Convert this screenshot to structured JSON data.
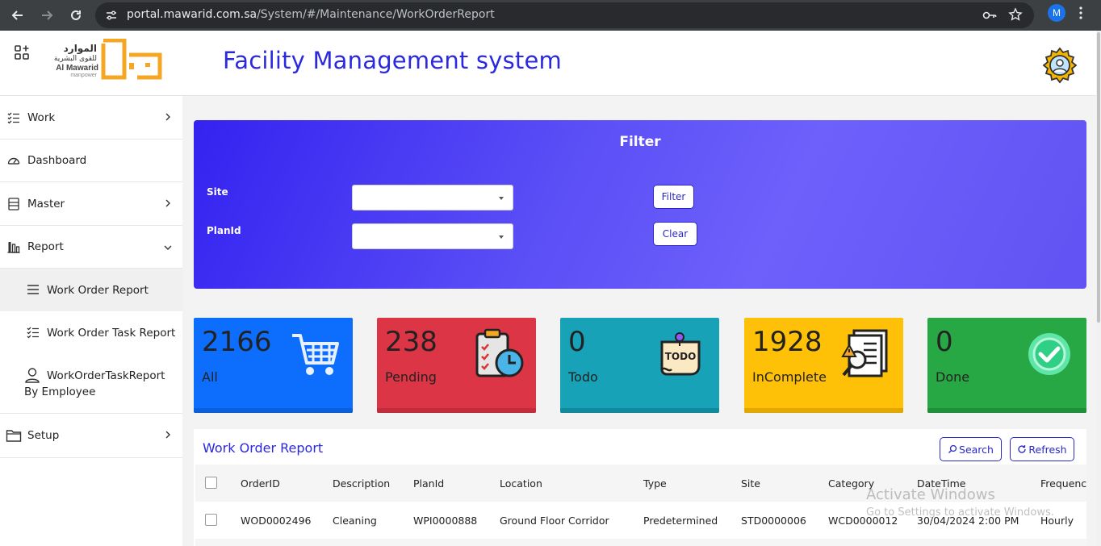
{
  "browser": {
    "url_host": "portal.mawarid.com.sa",
    "url_path": "/System/#/Maintenance/WorkOrderReport",
    "profile_initial": "M"
  },
  "header": {
    "logo_ar": "الموارد",
    "logo_ar_sub": "للقوى البشرية",
    "logo_en": "Al Mawarid",
    "logo_en_sub": "manpower",
    "title": "Facility Management system"
  },
  "sidebar": {
    "items": [
      {
        "label": "Work",
        "icon": "checklist-icon"
      },
      {
        "label": "Dashboard",
        "icon": "speedometer-icon"
      },
      {
        "label": "Master",
        "icon": "list-box-icon"
      },
      {
        "label": "Report",
        "icon": "bar-chart-icon"
      },
      {
        "label": "Work Order Report",
        "icon": "menu-lines-icon"
      },
      {
        "label": "Work Order Task Report",
        "icon": "checklist-icon"
      },
      {
        "label": "WorkOrderTaskReport",
        "label2": "By Employee",
        "icon": "person-icon"
      },
      {
        "label": "Setup",
        "icon": "folder-icon"
      }
    ]
  },
  "filter": {
    "title": "Filter",
    "site_label": "Site",
    "planid_label": "PlanId",
    "filter_button": "Filter",
    "clear_button": "Clear"
  },
  "stats": [
    {
      "value": "2166",
      "label": "All",
      "color": "#0d6efd",
      "icon": "shopping-cart-icon"
    },
    {
      "value": "238",
      "label": "Pending",
      "color": "#dc3545",
      "icon": "clipboard-clock-icon"
    },
    {
      "value": "0",
      "label": "Todo",
      "color": "#17a2b8",
      "icon": "todo-note-icon"
    },
    {
      "value": "1928",
      "label": "InComplete",
      "color": "#ffc107",
      "icon": "document-warning-icon"
    },
    {
      "value": "0",
      "label": "Done",
      "color": "#28a745",
      "icon": "check-circle-icon"
    }
  ],
  "report": {
    "title": "Work Order Report",
    "search_button": "Search",
    "refresh_button": "Refresh",
    "columns": [
      "OrderID",
      "Description",
      "PlanId",
      "Location",
      "Type",
      "Site",
      "Category",
      "DateTime",
      "Frequenc"
    ],
    "rows": [
      [
        "WOD0002496",
        "Cleaning",
        "WPI0000888",
        "Ground Floor Corridor",
        "Predetermined",
        "STD0000006",
        "WCD0000012",
        "30/04/2024 2:00 PM",
        "Hourly"
      ]
    ]
  },
  "watermark": {
    "line1": "Activate Windows",
    "line2": "Go to Settings to activate Windows."
  }
}
